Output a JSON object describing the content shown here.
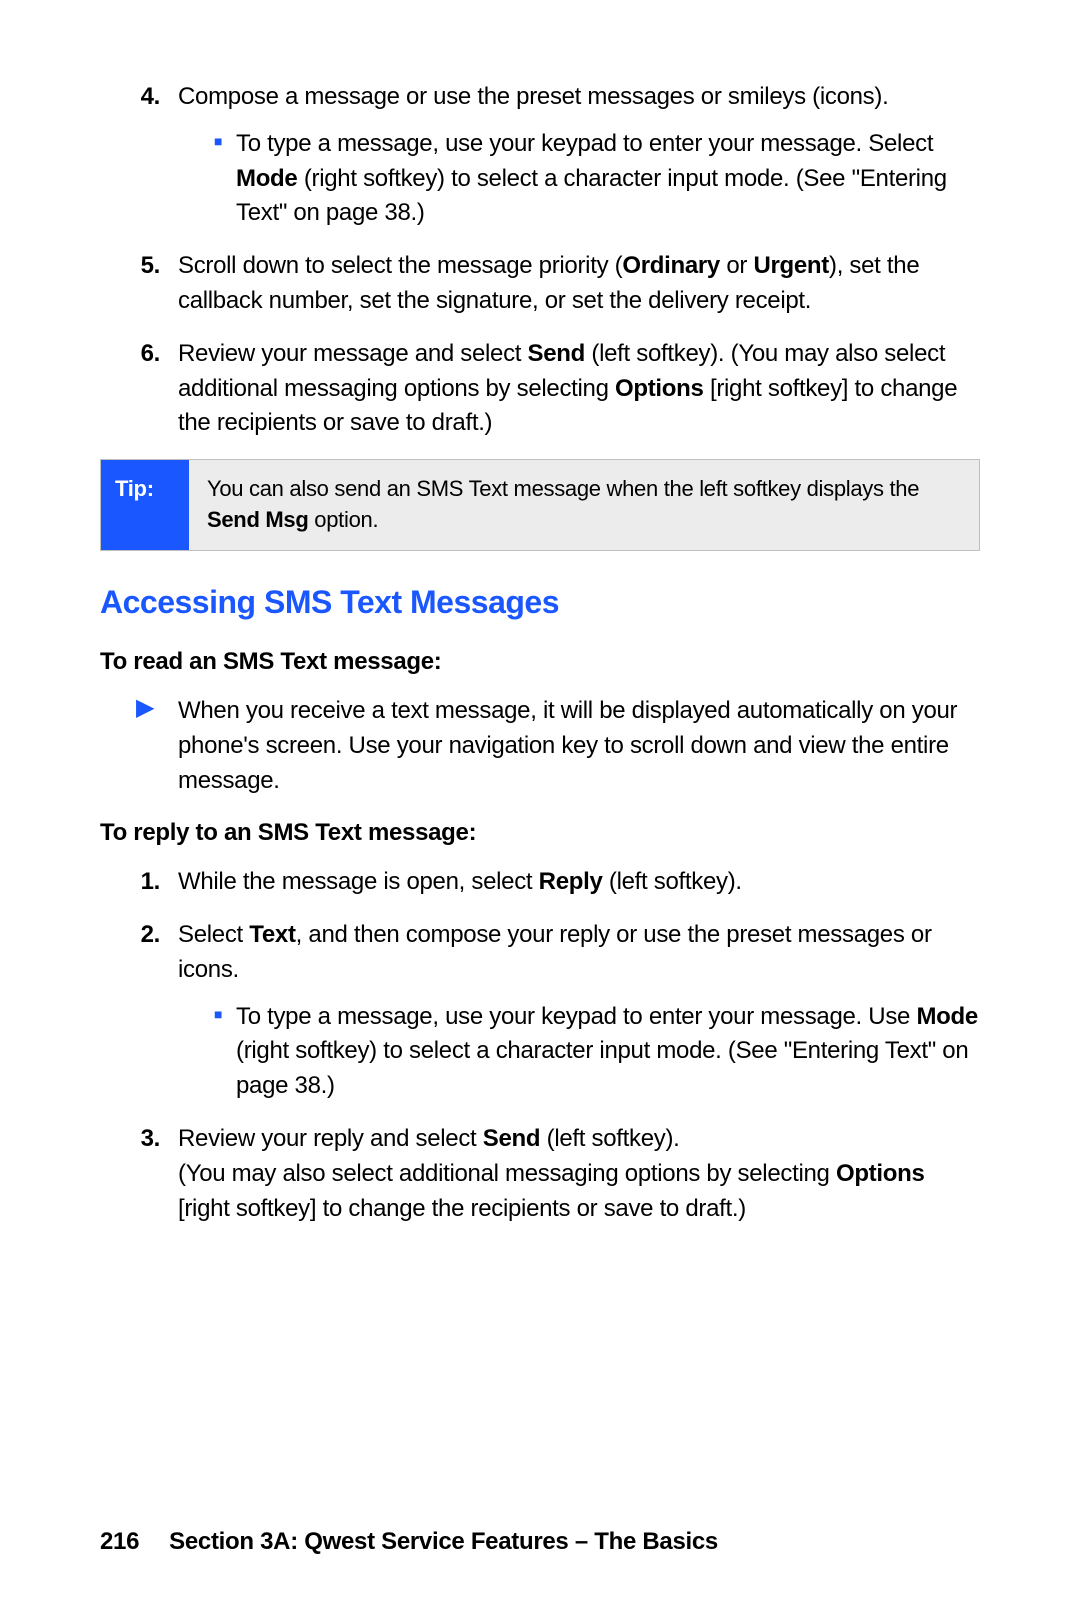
{
  "steps_a": {
    "s4": {
      "num": "4.",
      "text": "Compose a message or use the preset messages or smileys (icons).",
      "sub_pre": "To type a message, use your keypad to enter your message. Select ",
      "sub_bold": "Mode",
      "sub_post": " (right softkey) to select a character input mode. (See \"Entering Text\" on page 38.)"
    },
    "s5": {
      "num": "5.",
      "pre": "Scroll down to select the message priority (",
      "b1": "Ordinary",
      "mid": " or ",
      "b2": "Urgent",
      "post": "), set the callback number, set the signature, or set the delivery receipt."
    },
    "s6": {
      "num": "6.",
      "pre": "Review your message and select ",
      "b1": "Send",
      "mid": " (left softkey). (You may also select additional messaging options by selecting ",
      "b2": "Options",
      "post": " [right softkey] to change the recipients or save to draft.)"
    }
  },
  "tip": {
    "label": "Tip:",
    "pre": "You can also send an SMS Text message when the left softkey displays the ",
    "bold": "Send Msg",
    "post": " option."
  },
  "heading": "Accessing SMS Text Messages",
  "read": {
    "title": "To read an SMS Text message:",
    "body": "When you receive a text message, it will be displayed automatically on your phone's screen. Use your navigation key to scroll down and view the entire message."
  },
  "reply": {
    "title": "To reply to an SMS Text message:",
    "s1": {
      "num": "1.",
      "pre": "While the message is open, select ",
      "b": "Reply",
      "post": " (left softkey)."
    },
    "s2": {
      "num": "2.",
      "pre": "Select ",
      "b": "Text",
      "post": ", and then compose your reply or use the preset messages or icons.",
      "sub_pre": "To type a message, use your keypad to enter your message. Use ",
      "sub_b": "Mode",
      "sub_post": " (right softkey) to select a character input mode. (See \"Entering Text\" on page 38.)"
    },
    "s3": {
      "num": "3.",
      "pre": "Review your reply and select ",
      "b1": "Send",
      "mid": " (left softkey).",
      "line2_pre": "(You may also select additional messaging options by selecting ",
      "b2": "Options",
      "line2_post": " [right softkey] to change the recipients or save to draft.)"
    }
  },
  "footer": {
    "page": "216",
    "section": "Section 3A: Qwest Service Features – The Basics"
  }
}
